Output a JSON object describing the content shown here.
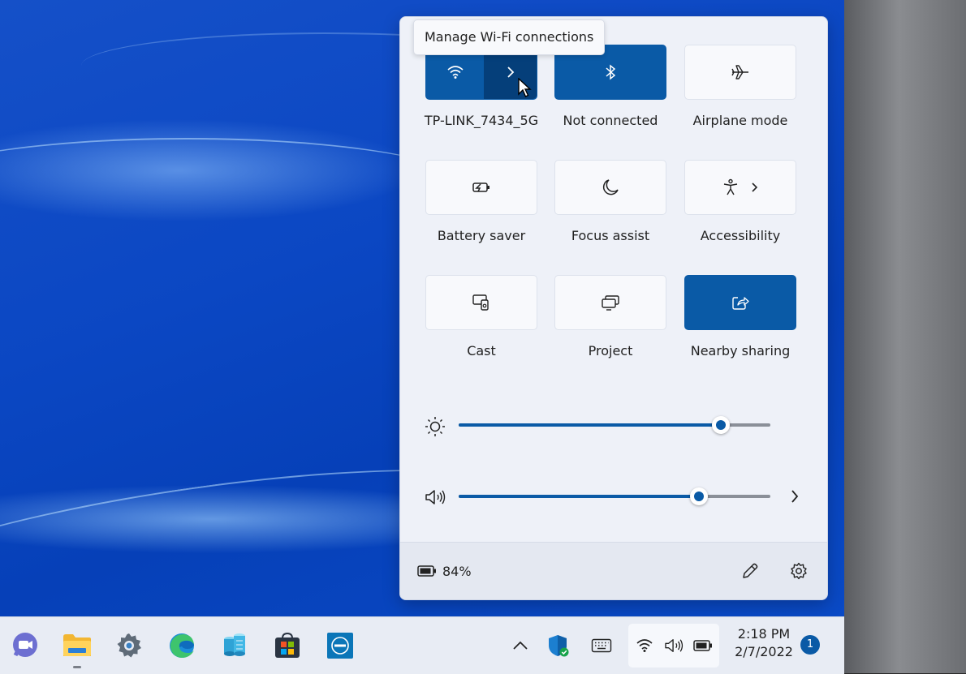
{
  "tooltip": {
    "text": "Manage Wi-Fi connections"
  },
  "quick_settings": {
    "tiles": [
      {
        "label": "TP-LINK_7434_5G",
        "icon": "wifi-icon",
        "state": "on",
        "split": true
      },
      {
        "label": "Not connected",
        "icon": "bluetooth-icon",
        "state": "on"
      },
      {
        "label": "Airplane mode",
        "icon": "airplane-icon",
        "state": "off"
      },
      {
        "label": "Battery saver",
        "icon": "battery-saver-icon",
        "state": "off"
      },
      {
        "label": "Focus assist",
        "icon": "moon-icon",
        "state": "off"
      },
      {
        "label": "Accessibility",
        "icon": "accessibility-icon",
        "state": "off",
        "chevron": true
      },
      {
        "label": "Cast",
        "icon": "cast-icon",
        "state": "off"
      },
      {
        "label": "Project",
        "icon": "project-icon",
        "state": "off"
      },
      {
        "label": "Nearby sharing",
        "icon": "share-icon",
        "state": "on"
      }
    ],
    "brightness": {
      "icon": "sun-icon",
      "value": 0.84
    },
    "volume": {
      "icon": "speaker-icon",
      "value": 0.77
    },
    "footer": {
      "battery_icon": "battery-icon",
      "battery_percent": "84%",
      "edit_icon": "pencil-icon",
      "settings_icon": "gear-icon"
    }
  },
  "taskbar": {
    "apps": [
      "teams-chat-icon",
      "file-explorer-icon",
      "settings-icon",
      "edge-icon",
      "azure-data-studio-icon",
      "microsoft-store-icon",
      "dell-icon"
    ],
    "tray": [
      "chevron-up-icon",
      "defender-icon",
      "keyboard-icon"
    ],
    "status": [
      "wifi-icon",
      "speaker-icon",
      "battery-icon"
    ],
    "clock": {
      "time": "2:18 PM",
      "date": "2/7/2022"
    },
    "notification_count": "1"
  },
  "colors": {
    "accent": "#0a5aa6",
    "accent_dark": "#053f7a",
    "panel_bg": "#eef1f8"
  }
}
